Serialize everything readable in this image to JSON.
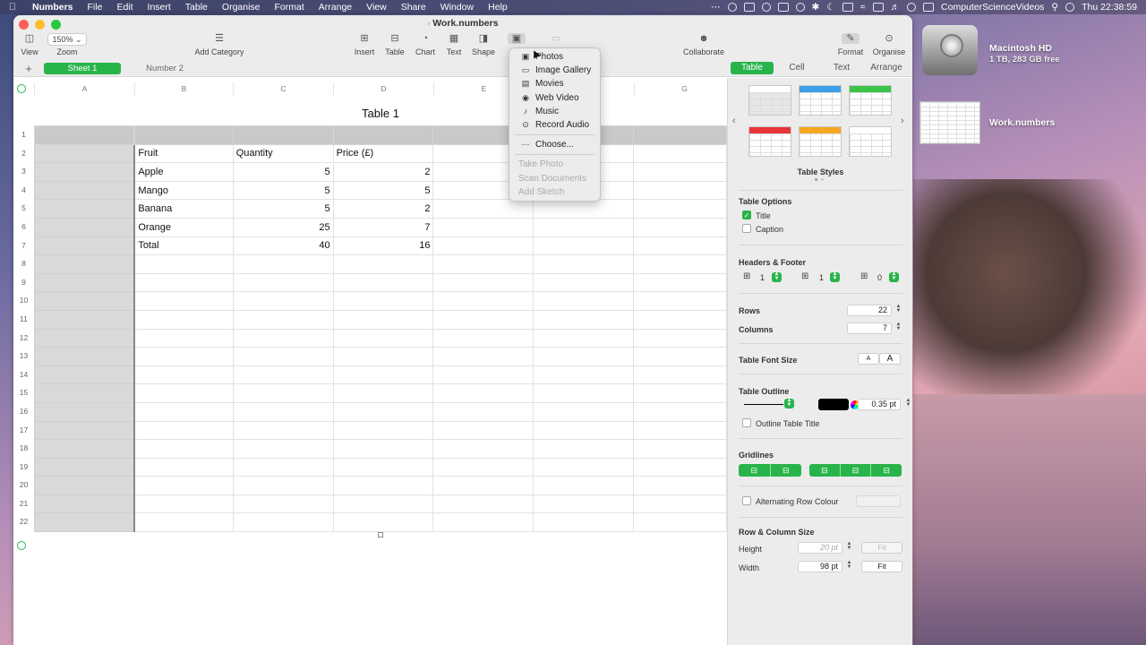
{
  "menubar": {
    "app": "Numbers",
    "items": [
      "File",
      "Edit",
      "Insert",
      "Table",
      "Organise",
      "Format",
      "Arrange",
      "View",
      "Share",
      "Window",
      "Help"
    ],
    "user": "ComputerScienceVideos",
    "clock": "Thu  22:38:59"
  },
  "window": {
    "title": "Work.numbers",
    "zoom": "150%",
    "toolbar": {
      "view": "View",
      "zoom": "Zoom",
      "add_category": "Add Category",
      "insert": "Insert",
      "table": "Table",
      "chart": "Chart",
      "text": "Text",
      "shape": "Shape",
      "collaborate": "Collaborate",
      "format": "Format",
      "organise": "Organise"
    }
  },
  "sheets": {
    "add": "+",
    "tabs": [
      "Sheet 1",
      "Number 2"
    ]
  },
  "sidebar_tabs": [
    "Table",
    "Cell",
    "Text",
    "Arrange"
  ],
  "spreadsheet": {
    "table_title": "Table 1",
    "columns": [
      "A",
      "B",
      "C",
      "D",
      "E",
      "F",
      "G"
    ],
    "rows": [
      [
        "",
        "",
        "",
        "",
        "",
        "",
        ""
      ],
      [
        "",
        "Fruit",
        "Quantity",
        "Price (£)",
        "",
        "",
        ""
      ],
      [
        "",
        "Apple",
        "5",
        "2",
        "",
        "",
        ""
      ],
      [
        "",
        "Mango",
        "5",
        "5",
        "",
        "",
        ""
      ],
      [
        "",
        "Banana",
        "5",
        "2",
        "",
        "",
        ""
      ],
      [
        "",
        "Orange",
        "25",
        "7",
        "",
        "",
        ""
      ],
      [
        "",
        "Total",
        "40",
        "16",
        "",
        "",
        ""
      ],
      [
        "",
        "",
        "",
        "",
        "",
        "",
        ""
      ],
      [
        "",
        "",
        "",
        "",
        "",
        "",
        ""
      ],
      [
        "",
        "",
        "",
        "",
        "",
        "",
        ""
      ],
      [
        "",
        "",
        "",
        "",
        "",
        "",
        ""
      ],
      [
        "",
        "",
        "",
        "",
        "",
        "",
        ""
      ],
      [
        "",
        "",
        "",
        "",
        "",
        "",
        ""
      ],
      [
        "",
        "",
        "",
        "",
        "",
        "",
        ""
      ],
      [
        "",
        "",
        "",
        "",
        "",
        "",
        ""
      ],
      [
        "",
        "",
        "",
        "",
        "",
        "",
        ""
      ],
      [
        "",
        "",
        "",
        "",
        "",
        "",
        ""
      ],
      [
        "",
        "",
        "",
        "",
        "",
        "",
        ""
      ],
      [
        "",
        "",
        "",
        "",
        "",
        "",
        ""
      ],
      [
        "",
        "",
        "",
        "",
        "",
        "",
        ""
      ],
      [
        "",
        "",
        "",
        "",
        "",
        "",
        ""
      ],
      [
        "",
        "",
        "",
        "",
        "",
        "",
        ""
      ]
    ]
  },
  "media_menu": {
    "items": [
      {
        "label": "Photos",
        "icon": "photos-icon"
      },
      {
        "label": "Image Gallery",
        "icon": "image-gallery-icon"
      },
      {
        "label": "Movies",
        "icon": "movies-icon"
      },
      {
        "label": "Web Video",
        "icon": "web-video-icon"
      },
      {
        "label": "Music",
        "icon": "music-icon"
      },
      {
        "label": "Record Audio",
        "icon": "microphone-icon"
      }
    ],
    "choose": "Choose...",
    "disabled": [
      "Take Photo",
      "Scan Documents",
      "Add Sketch"
    ]
  },
  "inspector": {
    "table_styles_label": "Table Styles",
    "style_header_colors": [
      "#ffffff",
      "#3aa0e8",
      "#3cc34a",
      "#e8353a",
      "#f5a623",
      "#ffffff"
    ],
    "table_options": {
      "heading": "Table Options",
      "title": "Title",
      "title_checked": true,
      "caption": "Caption",
      "caption_checked": false
    },
    "headers_footer": {
      "heading": "Headers & Footer",
      "header_rows": "1",
      "header_cols": "1",
      "footer_rows": "0"
    },
    "rows_label": "Rows",
    "rows_value": "22",
    "columns_label": "Columns",
    "columns_value": "7",
    "font_size": {
      "label": "Table Font Size",
      "smaller": "A",
      "larger": "A"
    },
    "outline": {
      "heading": "Table Outline",
      "width": "0.35 pt",
      "outline_title": "Outline Table Title"
    },
    "gridlines": "Gridlines",
    "alternating": "Alternating Row Colour",
    "row_col_size": {
      "heading": "Row & Column Size",
      "height_label": "Height",
      "height_value": "20 pt",
      "width_label": "Width",
      "width_value": "98 pt",
      "fit": "Fit"
    }
  },
  "desktop": {
    "disk_name": "Macintosh HD",
    "disk_info": "1 TB, 283 GB free",
    "file_name": "Work.numbers"
  },
  "colors": {
    "accent": "#28b44a"
  }
}
